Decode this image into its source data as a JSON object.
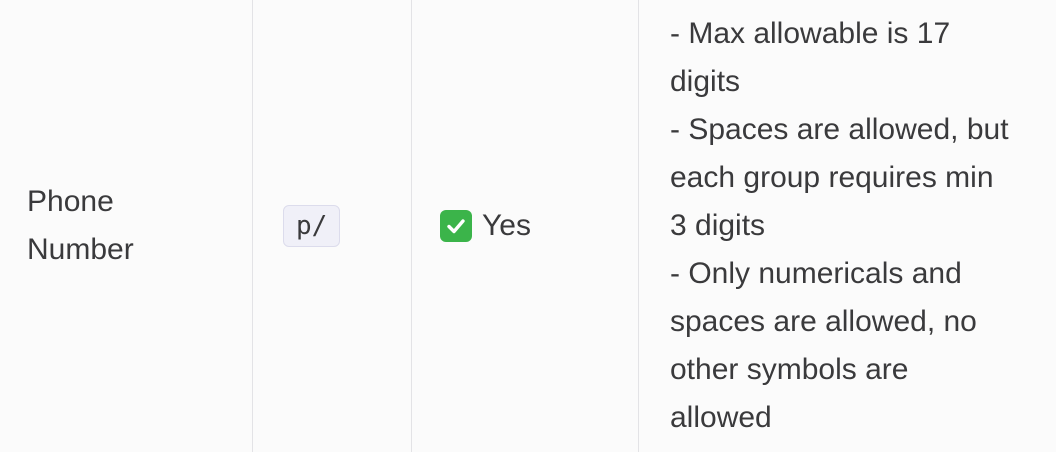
{
  "row": {
    "field_name_lines": [
      "Phone",
      "Number"
    ],
    "prefix": "p/",
    "required": {
      "icon": "check-mark-button-icon",
      "label": "Yes",
      "icon_color": "#3bb44a"
    },
    "notes_lines": [
      "- Max allowable is 17",
      "digits",
      "- Spaces are allowed, but",
      "each group requires min",
      "3 digits",
      "- Only numericals and",
      "spaces are allowed, no",
      "other symbols are",
      "allowed"
    ]
  }
}
